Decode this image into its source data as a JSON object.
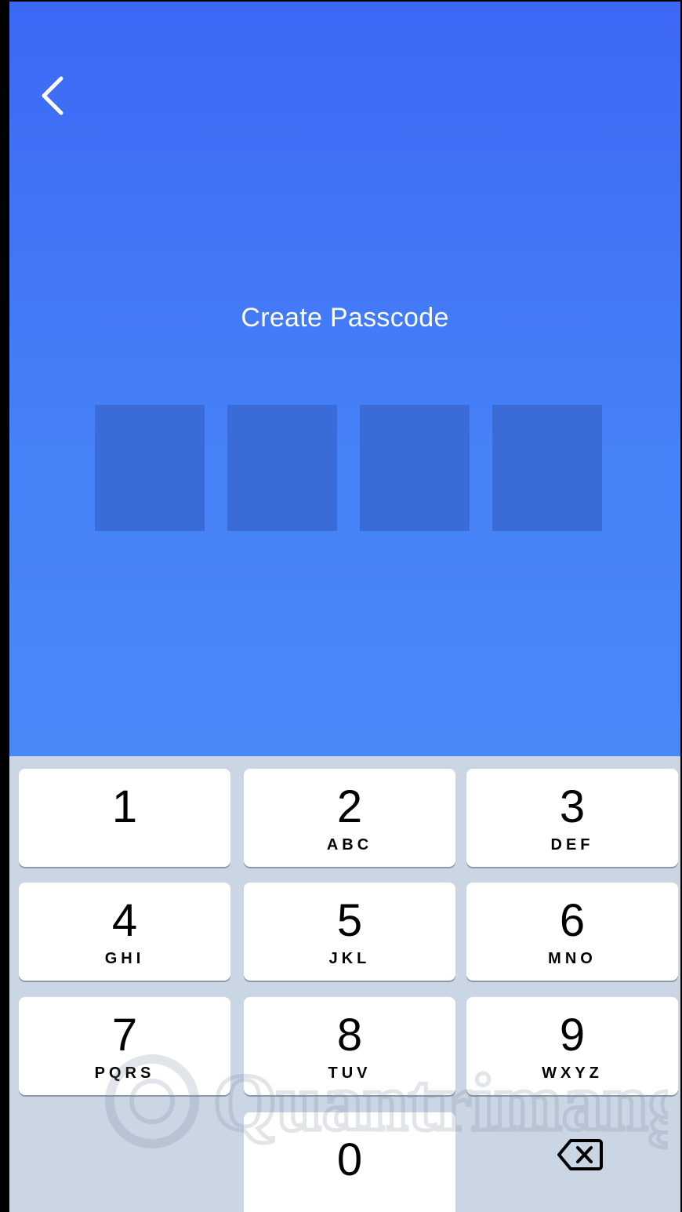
{
  "screen": {
    "title": "Create Passcode",
    "passcode_length": 4,
    "colors": {
      "header_top": "#3d68f6",
      "header_bottom": "#4a88f8",
      "code_box": "#3b6bd6",
      "keypad_bg": "#cbd6e5"
    },
    "back_icon": "chevron-left-icon"
  },
  "keypad": {
    "keys": [
      {
        "digit": "1",
        "letters": ""
      },
      {
        "digit": "2",
        "letters": "ABC"
      },
      {
        "digit": "3",
        "letters": "DEF"
      },
      {
        "digit": "4",
        "letters": "GHI"
      },
      {
        "digit": "5",
        "letters": "JKL"
      },
      {
        "digit": "6",
        "letters": "MNO"
      },
      {
        "digit": "7",
        "letters": "PQRS"
      },
      {
        "digit": "8",
        "letters": "TUV"
      },
      {
        "digit": "9",
        "letters": "WXYZ"
      },
      {
        "digit": "0",
        "letters": ""
      }
    ],
    "delete_icon": "backspace-icon"
  },
  "watermark": {
    "text": "Quantrimang"
  }
}
